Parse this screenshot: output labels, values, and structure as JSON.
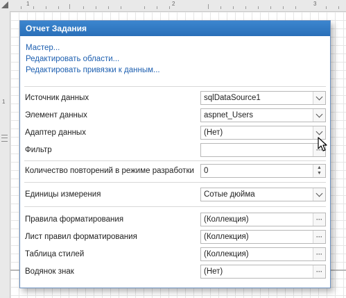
{
  "ruler": {
    "numbers": [
      "1",
      "2",
      "3"
    ],
    "left_numbers": [
      "1"
    ]
  },
  "panel": {
    "title": "Отчет Задания",
    "links": [
      "Мастер...",
      "Редактировать области...",
      "Редактировать привязки к данным..."
    ],
    "rows": [
      {
        "label": "Источник данных",
        "value": "sqlDataSource1",
        "control": "dropdown"
      },
      {
        "label": "Элемент данных",
        "value": "aspnet_Users",
        "control": "dropdown"
      },
      {
        "label": "Адаптер данных",
        "value": "(Нет)",
        "control": "dropdown"
      },
      {
        "label": "Фильтр",
        "value": "",
        "control": "ellipsis"
      },
      {
        "label": "Количество повторений в режиме разработки",
        "value": "0",
        "control": "spinner"
      },
      {
        "label": "Единицы измерения",
        "value": "Сотые дюйма",
        "control": "dropdown"
      },
      {
        "label": "Правила форматирования",
        "value": "(Коллекция)",
        "control": "ellipsis"
      },
      {
        "label": "Лист правил форматирования",
        "value": "(Коллекция)",
        "control": "ellipsis"
      },
      {
        "label": "Таблица стилей",
        "value": "(Коллекция)",
        "control": "ellipsis"
      },
      {
        "label": "Водянок знак",
        "value": "(Нет)",
        "control": "ellipsis"
      }
    ]
  },
  "colors": {
    "header": "#2f78c3",
    "link": "#1d5fb0",
    "border": "#6a8fbf"
  },
  "icons": {
    "dropdown": "chevron-down-icon",
    "ellipsis": "ellipsis-icon",
    "spinner": "spinner-icon",
    "cursor": "mouse-pointer-icon"
  }
}
